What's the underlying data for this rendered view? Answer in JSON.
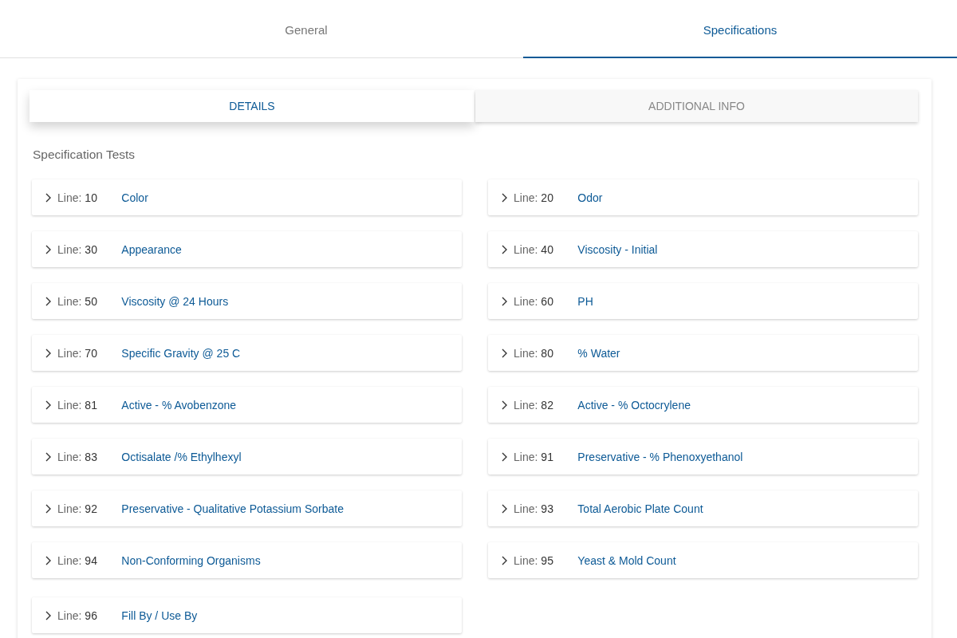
{
  "tabs": [
    {
      "label": "General",
      "selected": false
    },
    {
      "label": "Specifications",
      "selected": true
    }
  ],
  "subtabs": [
    {
      "label": "DETAILS",
      "selected": true
    },
    {
      "label": "ADDITIONAL INFO",
      "selected": false
    }
  ],
  "section_title": "Specification Tests",
  "tests": [
    {
      "label": "Line:",
      "line": "10",
      "name": "Color",
      "expanded": false
    },
    {
      "label": "Line:",
      "line": "20",
      "name": "Odor",
      "expanded": false
    },
    {
      "label": "Line:",
      "line": "30",
      "name": "Appearance",
      "expanded": false
    },
    {
      "label": "Line:",
      "line": "40",
      "name": "Viscosity - Initial",
      "expanded": false
    },
    {
      "label": "Line:",
      "line": "50",
      "name": "Viscosity @ 24 Hours",
      "expanded": false
    },
    {
      "label": "Line:",
      "line": "60",
      "name": "PH",
      "expanded": false
    },
    {
      "label": "Line:",
      "line": "70",
      "name": "Specific Gravity @ 25 C",
      "expanded": false
    },
    {
      "label": "Line:",
      "line": "80",
      "name": "% Water",
      "expanded": false
    },
    {
      "label": "Line:",
      "line": "81",
      "name": "Active - % Avobenzone",
      "expanded": false
    },
    {
      "label": "Line:",
      "line": "82",
      "name": "Active - % Octocrylene",
      "expanded": false
    },
    {
      "label": "Line:",
      "line": "83",
      "name": "Octisalate /% Ethylhexyl",
      "expanded": false
    },
    {
      "label": "Line:",
      "line": "91",
      "name": "Preservative - % Phenoxyethanol",
      "expanded": false
    },
    {
      "label": "Line:",
      "line": "92",
      "name": "Preservative - Qualitative Potassium Sorbate",
      "expanded": false
    },
    {
      "label": "Line:",
      "line": "93",
      "name": "Total Aerobic Plate Count",
      "expanded": false
    },
    {
      "label": "Line:",
      "line": "94",
      "name": "Non-Conforming Organisms",
      "expanded": false
    },
    {
      "label": "Line:",
      "line": "95",
      "name": "Yeast & Mold Count",
      "expanded": false
    },
    {
      "label": "Line:",
      "line": "96",
      "name": "Fill By / Use By",
      "expanded": false
    }
  ]
}
